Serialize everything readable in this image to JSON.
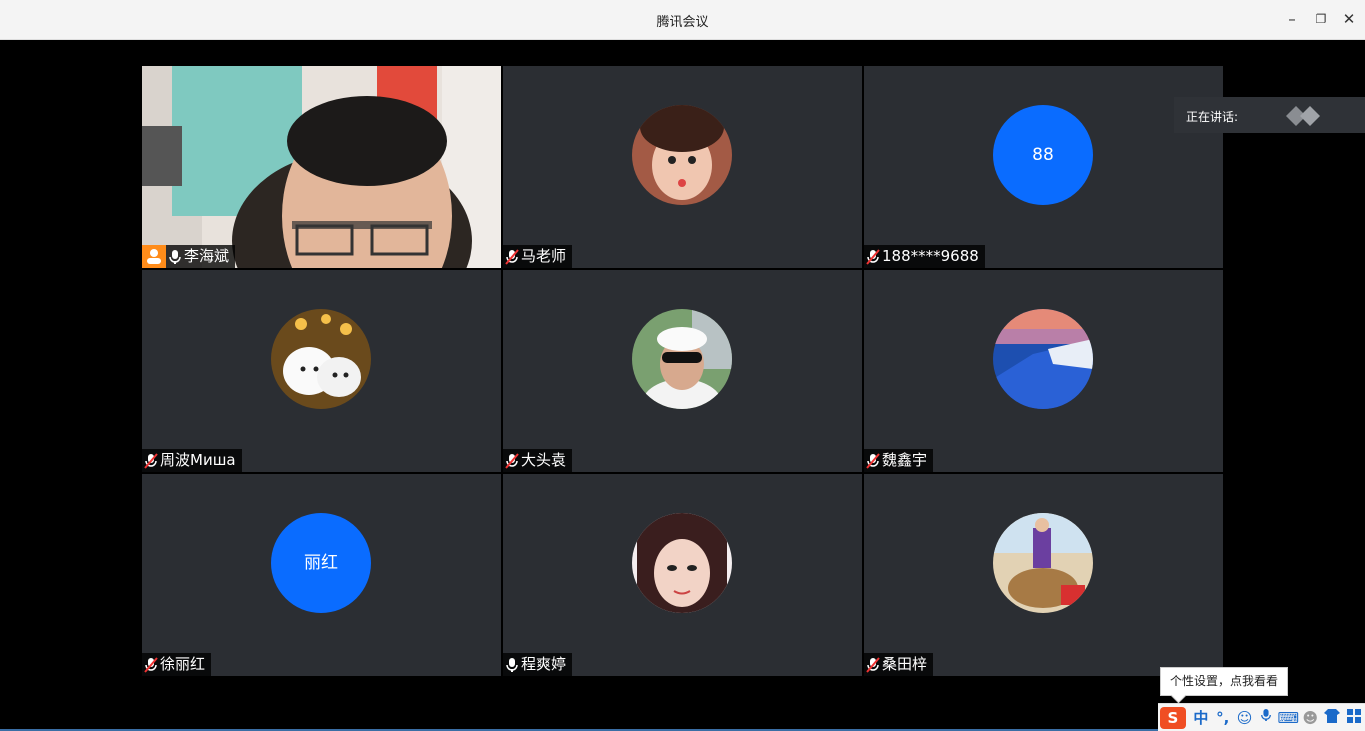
{
  "window": {
    "title": "腾讯会议",
    "minimize": "–",
    "restore": "❐",
    "close": "✕"
  },
  "speaking": {
    "label": "正在讲话:"
  },
  "participants": [
    {
      "name": "李海斌",
      "mic": "on",
      "host": true,
      "avatar": "video"
    },
    {
      "name": "马老师",
      "mic": "muted",
      "avatar": "photo"
    },
    {
      "name": "188****9688",
      "mic": "muted",
      "avatar": "text",
      "avatar_text": "88"
    },
    {
      "name": "周波Миша",
      "mic": "muted",
      "avatar": "photo"
    },
    {
      "name": "大头袁",
      "mic": "muted",
      "avatar": "photo"
    },
    {
      "name": "魏鑫宇",
      "mic": "muted",
      "avatar": "photo"
    },
    {
      "name": "徐丽红",
      "mic": "muted",
      "avatar": "text",
      "avatar_text": "丽红"
    },
    {
      "name": "程爽婷",
      "mic": "on",
      "avatar": "photo"
    },
    {
      "name": "桑田梓",
      "mic": "muted",
      "avatar": "photo"
    }
  ],
  "ime": {
    "tooltip": "个性设置，点我看看",
    "logo": "S",
    "mode": "中",
    "punct": "°,",
    "icons": [
      "emoji-icon",
      "microphone-icon",
      "keyboard-icon",
      "user-icon",
      "skin-icon",
      "grid-icon"
    ]
  },
  "colors": {
    "tile_bg": "#2b2e33",
    "avatar_blue": "#0a6cff",
    "host_badge": "#ff8c1a"
  }
}
